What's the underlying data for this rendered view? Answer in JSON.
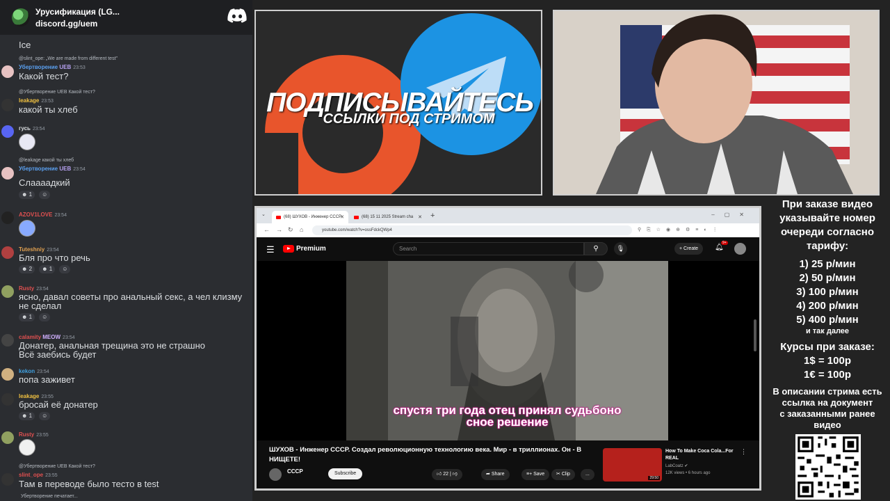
{
  "chat": {
    "server_name": "Урусификация (LG...",
    "server_link": "discord.gg/uem",
    "typing": "Убертворение печатает...",
    "messages": [
      {
        "body": "Ice"
      },
      {
        "reply": "@slint_ope: „We are made from different test\"",
        "author": "Убертворение",
        "badge": "UEB",
        "time": "23:53",
        "body": "Какой тест?"
      },
      {
        "reply": "@Убертворение UEB Какой тест?",
        "author": "leakage",
        "time": "23:53",
        "body": "какой ты хлеб"
      },
      {
        "author": "гусь",
        "time": "23:54",
        "body": ""
      },
      {
        "reply": "@leakage какой ты хлеб",
        "author": "Убертворение",
        "badge": "UEB",
        "time": "23:54",
        "body": "Слаааадкий",
        "reactions": [
          "1"
        ]
      },
      {
        "author": "AZOV1LOVE",
        "time": "23:54",
        "body": ""
      },
      {
        "author": "Tuteshniy",
        "time": "23:54",
        "body": "Бля про что речь",
        "reactions": [
          "2",
          "1"
        ]
      },
      {
        "author": "Rusty",
        "time": "23:54",
        "body": "ясно, давал советы про анальный секс, а чел клизму",
        "body2": "не сделал",
        "reactions": [
          "1"
        ]
      },
      {
        "author": "calamity",
        "badge": "MEOW",
        "time": "23:54",
        "body": "Донатер, анальная трещина это не страшно",
        "body2": "Всё заебись будет"
      },
      {
        "author": "kekon",
        "time": "23:54",
        "body": "попа заживет"
      },
      {
        "author": "leakage",
        "time": "23:55",
        "body": "бросай её донатер",
        "reactions": [
          "1"
        ]
      },
      {
        "author": "Rusty",
        "time": "23:55",
        "body": ""
      },
      {
        "reply": "@Убертворение UEB Какой тест?",
        "author": "slint_ope",
        "time": "23:55",
        "body": "Там в переводе было тесто в test"
      }
    ]
  },
  "banner": {
    "title": "ПОДПИСЫВАЙТЕСЬ",
    "subtitle": "ССЫЛКИ ПОД СТРИМОМ"
  },
  "browser": {
    "tab1": "(68) ШУХОВ - Инженер СССР",
    "tab2": "(68) 15 11 2025 Stream cha",
    "url": "youtube.com/watch?v=ossFdckQWp4"
  },
  "youtube": {
    "logo": "Premium",
    "search_placeholder": "Search",
    "create": "Create",
    "notifications": "9+",
    "subtitle_line1": "спустя три года отец принял судьбоно",
    "subtitle_line2": "сное решение",
    "video_title": "ШУХОВ - Инженер СССР. Создал революционную технологию века. Мир - в триллионах. Он - В НИЩЕТЕ!",
    "channel": "СССР",
    "channel_subs": "",
    "subscribe": "Subscribe",
    "likes": "22",
    "share": "Share",
    "save": "Save",
    "clip": "Clip",
    "more": "...",
    "rec_title": "How To Make Coca Cola...For REAL",
    "rec_channel": "LabCoatz",
    "rec_meta": "12K views • 6 hours ago",
    "rec_duration": "29:50"
  },
  "info": {
    "line1": "При заказе видео",
    "line2": "указывайте номер",
    "line3": "очереди согласно",
    "line4": "тарифу:",
    "tiers": [
      "1) 25 р/мин",
      "2) 50 р/мин",
      "3) 100 р/мин",
      "4) 200 р/мин",
      "5) 400 р/мин"
    ],
    "etc": "и так далее",
    "courses_title": "Курсы при заказе:",
    "rate1": "1$ = 100р",
    "rate2": "1€ = 100р",
    "desc1": "В описании стрима есть",
    "desc2": "ссылка на документ",
    "desc3": "с заказанными ранее",
    "desc4": "видео"
  },
  "colors": {
    "discord_bg": "#2b2d31",
    "telegram_blue": "#1c93e3",
    "patreon_orange": "#e8552c",
    "yt_red": "#ff0000"
  }
}
